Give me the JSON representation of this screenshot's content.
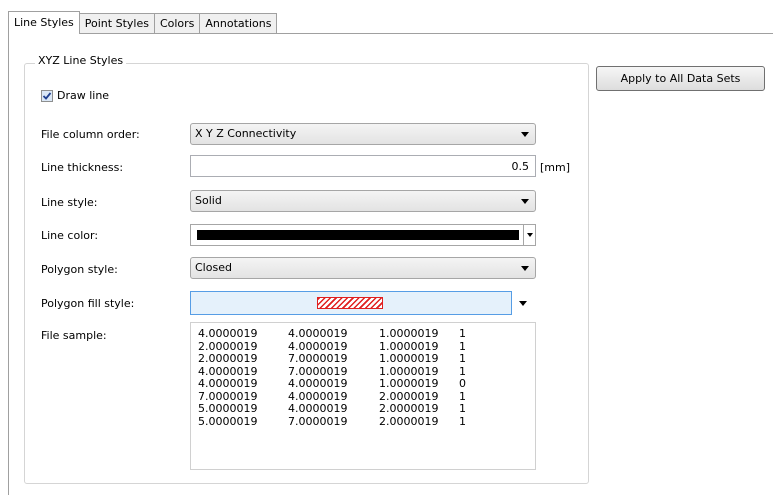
{
  "tabs": [
    {
      "label": "Line Styles",
      "active": true
    },
    {
      "label": "Point Styles",
      "active": false
    },
    {
      "label": "Colors",
      "active": false
    },
    {
      "label": "Annotations",
      "active": false
    }
  ],
  "group": {
    "title": "XYZ Line Styles"
  },
  "apply_button": {
    "label": "Apply to All Data Sets"
  },
  "draw_line": {
    "label": "Draw line",
    "checked": true
  },
  "fields": {
    "file_column_order": {
      "label": "File column order:",
      "value": "X Y Z Connectivity"
    },
    "line_thickness": {
      "label": "Line thickness:",
      "value": "0.5",
      "unit": "[mm]"
    },
    "line_style": {
      "label": "Line style:",
      "value": "Solid"
    },
    "line_color": {
      "label": "Line color:",
      "color": "#000000"
    },
    "polygon_style": {
      "label": "Polygon style:",
      "value": "Closed"
    },
    "polygon_fill_style": {
      "label": "Polygon fill style:",
      "pattern": "diagonal-hatch",
      "color": "#e02020"
    },
    "file_sample": {
      "label": "File sample:"
    }
  },
  "file_sample_rows": [
    [
      "4.0000019",
      "4.0000019",
      "1.0000019",
      "1"
    ],
    [
      "2.0000019",
      "4.0000019",
      "1.0000019",
      "1"
    ],
    [
      "2.0000019",
      "7.0000019",
      "1.0000019",
      "1"
    ],
    [
      "4.0000019",
      "7.0000019",
      "1.0000019",
      "1"
    ],
    [
      "4.0000019",
      "4.0000019",
      "1.0000019",
      "0"
    ],
    [
      "7.0000019",
      "4.0000019",
      "2.0000019",
      "1"
    ],
    [
      "5.0000019",
      "4.0000019",
      "2.0000019",
      "1"
    ],
    [
      "5.0000019",
      "7.0000019",
      "2.0000019",
      "1"
    ]
  ],
  "icons": {
    "checkbox": "checkmark-icon",
    "dropdown": "chevron-down-icon"
  }
}
